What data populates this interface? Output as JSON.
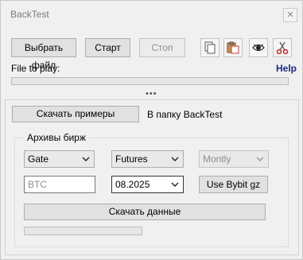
{
  "window": {
    "title": "BackTest",
    "close_glyph": "✕"
  },
  "toolbar": {
    "select_file_label": "Выбрать файл",
    "start_label": "Старт",
    "stop_label": "Стоп",
    "icons": [
      "copy-icon",
      "paste-icon",
      "eye-icon",
      "scissors-icon"
    ]
  },
  "file": {
    "label": "File to play:",
    "help_label": "Help",
    "progress": 0
  },
  "splitter": {
    "grip": "•••"
  },
  "samples": {
    "download_label": "Скачать примеры",
    "target_text": "В папку BackTest"
  },
  "archives": {
    "title": "Архивы бирж",
    "exchange": {
      "value": "Gate"
    },
    "market": {
      "value": "Futures"
    },
    "period": {
      "value": "Montly"
    },
    "symbol": {
      "placeholder": "BTC"
    },
    "month": {
      "value": "08.2025"
    },
    "bybit_label": "Use Bybit gz",
    "download_data_label": "Скачать данные",
    "progress": 0
  }
}
